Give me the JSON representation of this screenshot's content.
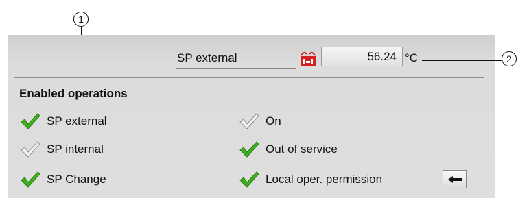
{
  "callouts": {
    "one": "1",
    "two": "2"
  },
  "setpoint": {
    "label": "SP external",
    "value": "56.24",
    "unit": "°C",
    "icon": "external-setpoint-icon",
    "icon_color": "#d42020"
  },
  "operations": {
    "title": "Enabled operations",
    "items": [
      {
        "label": "SP external",
        "enabled": true
      },
      {
        "label": "SP internal",
        "enabled": false
      },
      {
        "label": "SP Change",
        "enabled": true
      },
      {
        "label": "On",
        "enabled": false
      },
      {
        "label": "Out of service",
        "enabled": true
      },
      {
        "label": "Local oper. permission",
        "enabled": true
      }
    ]
  },
  "arrow_button": {
    "icon": "arrow-left-icon"
  },
  "colors": {
    "check_enabled": "#3fae1f",
    "check_disabled": "#f2f2f2",
    "panel": "#dcdcdc"
  }
}
